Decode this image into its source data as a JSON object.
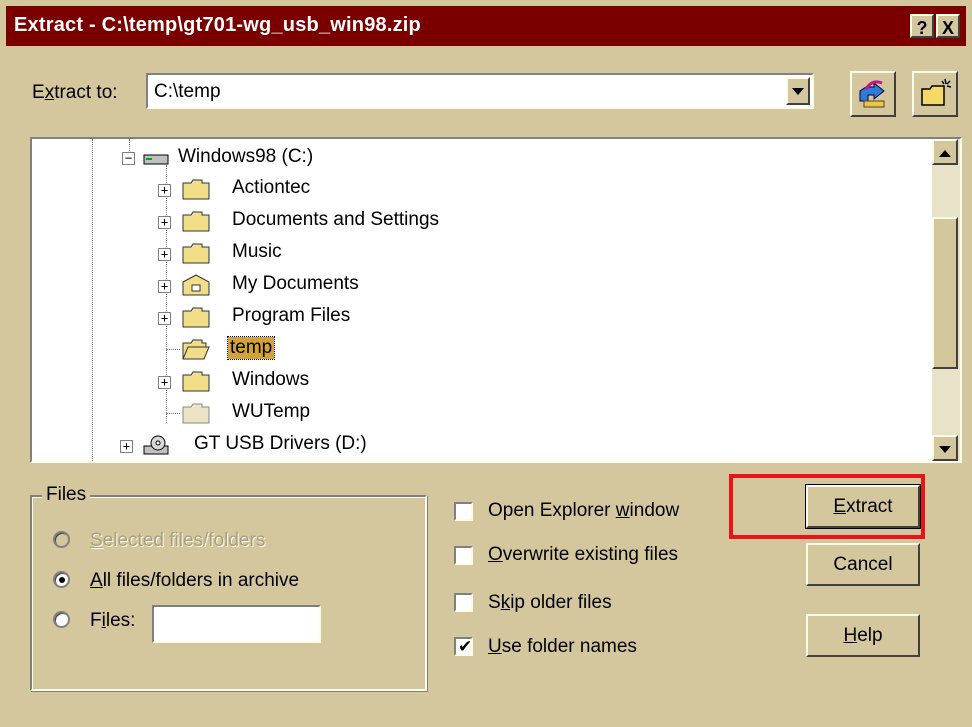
{
  "window": {
    "title": "Extract - C:\\temp\\gt701-wg_usb_win98.zip",
    "help_btn": "?",
    "close_btn": "X"
  },
  "extract_to": {
    "label_pre": "E",
    "label_u": "x",
    "label_post": "tract to:",
    "value": "C:\\temp",
    "icons": [
      "go-up-folder-icon",
      "new-folder-icon"
    ]
  },
  "tree": {
    "root": "Windows98 (C:)",
    "folders": [
      {
        "label": "Actiontec",
        "expandable": true,
        "icon": "folder-icon"
      },
      {
        "label": "Documents and Settings",
        "expandable": true,
        "icon": "folder-icon"
      },
      {
        "label": "Music",
        "expandable": true,
        "icon": "folder-icon"
      },
      {
        "label": "My Documents",
        "expandable": true,
        "icon": "my-documents-folder-icon"
      },
      {
        "label": "Program Files",
        "expandable": true,
        "icon": "folder-icon"
      },
      {
        "label": "temp",
        "expandable": false,
        "icon": "open-folder-icon",
        "selected": true
      },
      {
        "label": "Windows",
        "expandable": true,
        "icon": "folder-icon"
      },
      {
        "label": "WUTemp",
        "expandable": false,
        "icon": "folder-icon"
      }
    ],
    "drive2": "GT USB Drivers (D:)"
  },
  "files_group": {
    "title": "Files",
    "opt_selected": {
      "u": "S",
      "rest": "elected files/folders"
    },
    "opt_all": {
      "u": "A",
      "rest": "ll files/folders in archive"
    },
    "opt_files": {
      "pre": "F",
      "u": "i",
      "rest": "les:"
    },
    "files_value": ""
  },
  "options": {
    "open_explorer": {
      "pre": "Open Explorer ",
      "u": "w",
      "rest": "indow",
      "checked": false
    },
    "overwrite": {
      "u": "O",
      "rest": "verwrite existing files",
      "checked": false
    },
    "skip_older": {
      "pre": "S",
      "u": "k",
      "rest": "ip older files",
      "checked": false
    },
    "use_folder_names": {
      "u": "U",
      "rest": "se folder names",
      "checked": true
    }
  },
  "buttons": {
    "extract": {
      "u": "E",
      "rest": "xtract"
    },
    "cancel": "Cancel",
    "help": {
      "u": "H",
      "rest": "elp"
    }
  },
  "colors": {
    "dialog_bg": "#d4c79e",
    "titlebar": "#7a0000",
    "highlight": "#e8141b",
    "selection": "#d4a23a"
  }
}
